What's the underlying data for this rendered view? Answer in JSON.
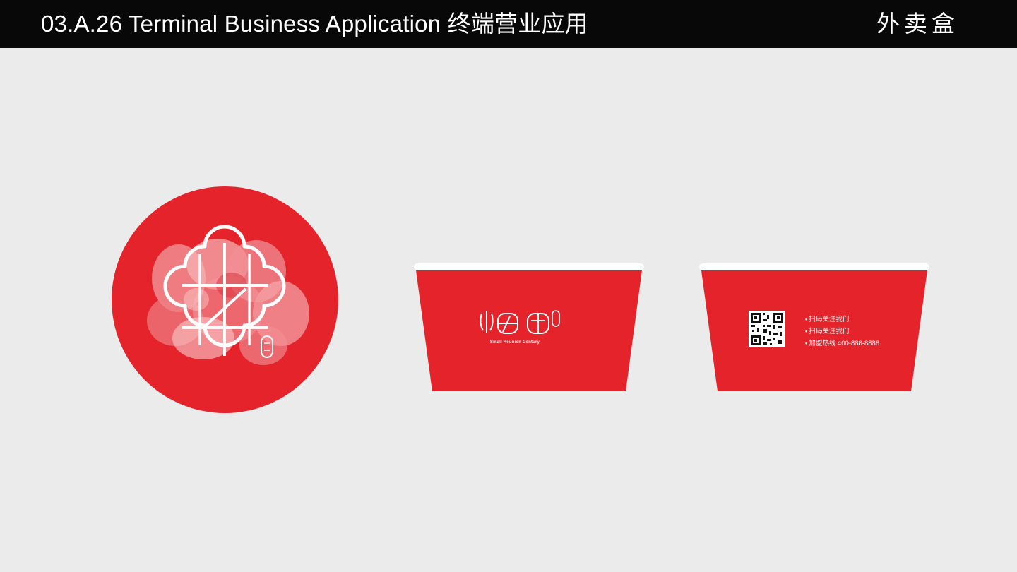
{
  "header": {
    "title": "03.A.26 Terminal Business Application 终端营业应用",
    "section": "外卖盒"
  },
  "colors": {
    "background": "#ebebeb",
    "topbar": "#080808",
    "brand_red": "#e4232b",
    "rim": "#ffffff"
  },
  "bowl_front": {
    "brand_en": "Small Reunion Century"
  },
  "bowl_back": {
    "lines": [
      "扫码关注我们",
      "扫码关注我们",
      "加盟热线 400-888-8888"
    ]
  }
}
